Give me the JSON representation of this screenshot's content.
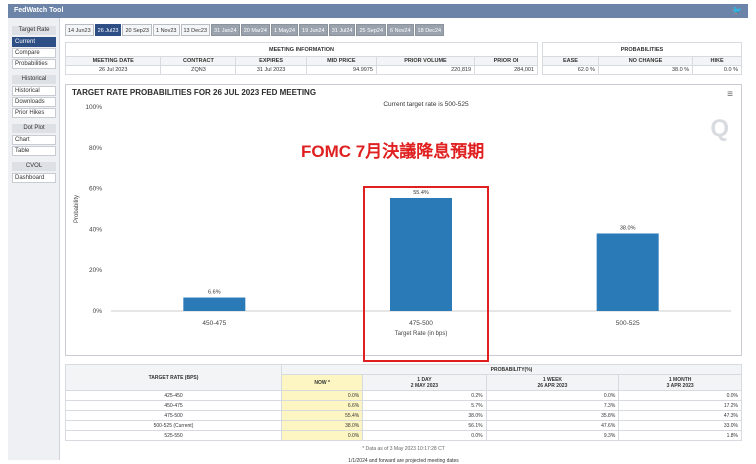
{
  "app": {
    "title": "FedWatch Tool",
    "twitter_icon": "twitter-icon"
  },
  "sidebar": {
    "items": [
      {
        "label": "Target Rate",
        "type": "head"
      },
      {
        "label": "Current",
        "active": true
      },
      {
        "label": "Compare"
      },
      {
        "label": "Probabilities"
      },
      {
        "label": "Historical",
        "type": "head"
      },
      {
        "label": "Historical"
      },
      {
        "label": "Downloads"
      },
      {
        "label": "Prior Hikes"
      },
      {
        "label": "Dot Plot",
        "type": "head"
      },
      {
        "label": "Chart"
      },
      {
        "label": "Table"
      },
      {
        "label": "CVOL",
        "type": "head"
      },
      {
        "label": "Dashboard"
      }
    ]
  },
  "tabs": [
    {
      "label": "14 Jun23",
      "state": "normal"
    },
    {
      "label": "26 Jul23",
      "state": "active"
    },
    {
      "label": "20 Sep23",
      "state": "normal"
    },
    {
      "label": "1 Nov23",
      "state": "normal"
    },
    {
      "label": "13 Dec23",
      "state": "normal"
    },
    {
      "label": "31 Jan24",
      "state": "dim"
    },
    {
      "label": "20 Mar24",
      "state": "dim"
    },
    {
      "label": "1 May24",
      "state": "dim"
    },
    {
      "label": "19 Jun24",
      "state": "dim"
    },
    {
      "label": "31 Jul24",
      "state": "dim"
    },
    {
      "label": "25 Sep24",
      "state": "dim"
    },
    {
      "label": "6 Nov24",
      "state": "dim"
    },
    {
      "label": "18 Dec24",
      "state": "dim"
    }
  ],
  "meeting_info": {
    "section_title": "MEETING INFORMATION",
    "headers": [
      "MEETING DATE",
      "CONTRACT",
      "EXPIRES",
      "MID PRICE",
      "PRIOR VOLUME",
      "PRIOR OI"
    ],
    "values": [
      "26 Jul 2023",
      "ZQN3",
      "31 Jul 2023",
      "94.9975",
      "220,819",
      "284,001"
    ]
  },
  "probabilities": {
    "section_title": "PROBABILITIES",
    "headers": [
      "EASE",
      "NO CHANGE",
      "HIKE"
    ],
    "values": [
      "62.0 %",
      "38.0 %",
      "0.0 %"
    ]
  },
  "chart": {
    "title": "TARGET RATE PROBABILITIES FOR 26 JUL 2023 FED MEETING",
    "subtitle": "Current target rate is 500-525",
    "menu_icon": "hamburger-menu-icon",
    "watermark": "Q",
    "overlay_text": "FOMC 7月決議降息預期"
  },
  "chart_data": {
    "type": "bar",
    "title": "TARGET RATE PROBABILITIES FOR 26 JUL 2023 FED MEETING",
    "subtitle": "Current target rate is 500-525",
    "categories": [
      "450-475",
      "475-500",
      "500-525"
    ],
    "values": [
      6.6,
      55.4,
      38.0
    ],
    "data_labels": [
      "6.6%",
      "55.4%",
      "38.0%"
    ],
    "xlabel": "Target Rate (in bps)",
    "ylabel": "Probability",
    "ylim": [
      0,
      100
    ],
    "yticks": [
      "0%",
      "20%",
      "40%",
      "60%",
      "80%",
      "100%"
    ],
    "bar_color": "#2a7ab8",
    "grid": false
  },
  "detail_table": {
    "col1_header": "TARGET RATE (BPS)",
    "prob_header": "PROBABILITY(%)",
    "sub_headers": [
      {
        "line1": "NOW *",
        "line2": ""
      },
      {
        "line1": "1 DAY",
        "line2": "2 MAY 2023"
      },
      {
        "line1": "1 WEEK",
        "line2": "26 APR 2023"
      },
      {
        "line1": "1 MONTH",
        "line2": "3 APR 2023"
      }
    ],
    "rows": [
      {
        "rate": "425-450",
        "now": "0.0%",
        "day": "0.2%",
        "week": "0.0%",
        "month": "0.0%"
      },
      {
        "rate": "450-475",
        "now": "6.6%",
        "day": "5.7%",
        "week": "7.3%",
        "month": "17.2%"
      },
      {
        "rate": "475-500",
        "now": "55.4%",
        "day": "38.0%",
        "week": "35.8%",
        "month": "47.3%"
      },
      {
        "rate": "500-525 (Current)",
        "now": "38.0%",
        "day": "56.1%",
        "week": "47.6%",
        "month": "33.0%"
      },
      {
        "rate": "525-550",
        "now": "0.0%",
        "day": "0.0%",
        "week": "9.3%",
        "month": "1.8%"
      }
    ],
    "footnote": "* Data as of 3 May 2023 10:17:28 CT",
    "footer": "1/1/2024 and forward are projected meeting dates"
  }
}
